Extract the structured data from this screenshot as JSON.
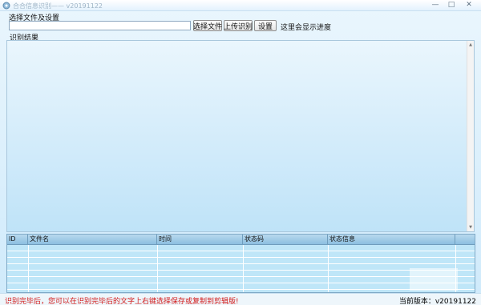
{
  "window": {
    "title": "合合信息识别—— v20191122",
    "controls": [
      "minimize",
      "maximize",
      "close"
    ]
  },
  "settings": {
    "label": "选择文件及设置",
    "file_input_value": "",
    "buttons": {
      "select_file": "选择文件",
      "upload_recognize": "上传识别",
      "settings": "设置"
    },
    "progress_text": "这里会显示进度"
  },
  "result": {
    "label": "识别结果",
    "content": ""
  },
  "table": {
    "columns": [
      "ID",
      "文件名",
      "时间",
      "状态码",
      "状态信息"
    ],
    "rows": []
  },
  "status_bar": {
    "message": "识别完毕后，您可以在识别完毕后的文字上右键选择保存或复制到剪辑版!",
    "version": "当前版本：v20191122"
  },
  "colors": {
    "status_message": "#d21a1a",
    "background": "#cfeafb",
    "grid_header": "#8cbfe0"
  }
}
